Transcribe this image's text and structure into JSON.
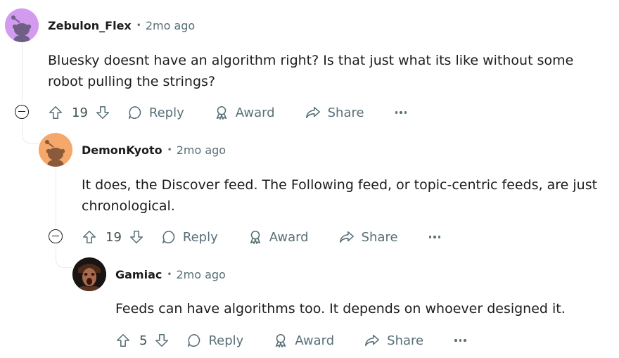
{
  "comments": [
    {
      "author": "Zebulon_Flex",
      "separator": "•",
      "time": "2mo ago",
      "body": "Bluesky doesnt have an algorithm right? Is that just what its like without some robot pulling the strings?",
      "votes": "19",
      "avatar_color": "#d39bf0",
      "avatar_icon": "snoo-icon"
    },
    {
      "author": "DemonKyoto",
      "separator": "•",
      "time": "2mo ago",
      "body": "It does, the Discover feed. The Following feed, or topic-centric feeds, are just chronological.",
      "votes": "19",
      "avatar_color": "#f6a86a",
      "avatar_icon": "snoo-icon"
    },
    {
      "author": "Gamiac",
      "separator": "•",
      "time": "2mo ago",
      "body": "Feeds can have algorithms too. It depends on whoever designed it.",
      "votes": "5",
      "avatar_color": "#2a2220",
      "avatar_icon": "profile-photo"
    }
  ],
  "actions": {
    "reply": "Reply",
    "award": "Award",
    "share": "Share"
  },
  "colors": {
    "text": "#1c1c1c",
    "muted": "#576f76",
    "thread_line": "#e5ebee"
  }
}
